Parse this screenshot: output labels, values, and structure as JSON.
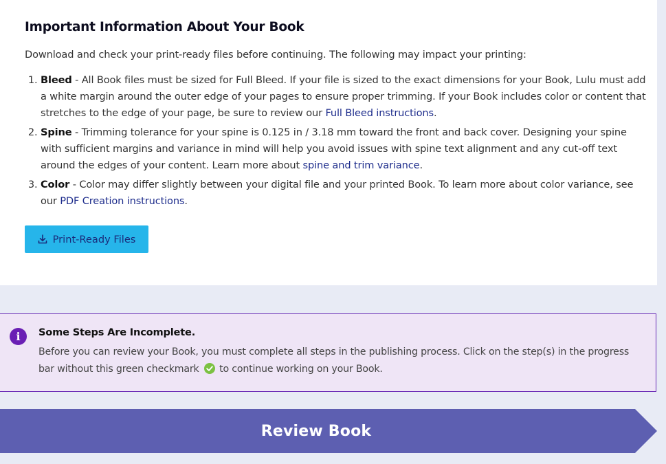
{
  "section": {
    "title": "Important Information About Your Book",
    "intro": "Download and check your print-ready files before continuing. The following may impact your printing:",
    "items": [
      {
        "term": "Bleed",
        "text": " - All Book files must be sized for Full Bleed. If your file is sized to the exact dimensions for your Book, Lulu must add a white margin around the outer edge of your pages to ensure proper trimming. If your Book includes color or content that stretches to the edge of your page, be sure to review our ",
        "link": "Full Bleed instructions",
        "after": "."
      },
      {
        "term": "Spine",
        "text": " - Trimming tolerance for your spine is 0.125 in / 3.18 mm toward the front and back cover. Designing your spine with sufficient margins and variance in mind will help you avoid issues with spine text alignment and any cut-off text around the edges of your content. Learn more about ",
        "link": "spine and trim variance",
        "after": "."
      },
      {
        "term": "Color",
        "text": " - Color may differ slightly between your digital file and your printed Book. To learn more about color variance, see our ",
        "link": "PDF Creation instructions",
        "after": "."
      }
    ],
    "download_button": {
      "label": "Print-Ready Files",
      "icon": "download-icon"
    }
  },
  "alert": {
    "icon": "info-icon",
    "icon_glyph": "i",
    "title": "Some Steps Are Incomplete.",
    "body_before": "Before you can review your Book, you must complete all steps in the publishing process. Click on the step(s) in the progress bar without this green checkmark",
    "body_after": " to continue working on your Book.",
    "check_icon": "green-checkmark-icon"
  },
  "review_button": {
    "label": "Review Book"
  },
  "colors": {
    "page_bg": "#e8ebf5",
    "button_blue": "#26b5ea",
    "link": "#1e2d8c",
    "alert_bg": "#efe5f6",
    "alert_border": "#6a2ab5",
    "info_icon": "#6a1fb4",
    "check_green": "#7cc142",
    "review_purple": "#5d5fb1"
  }
}
